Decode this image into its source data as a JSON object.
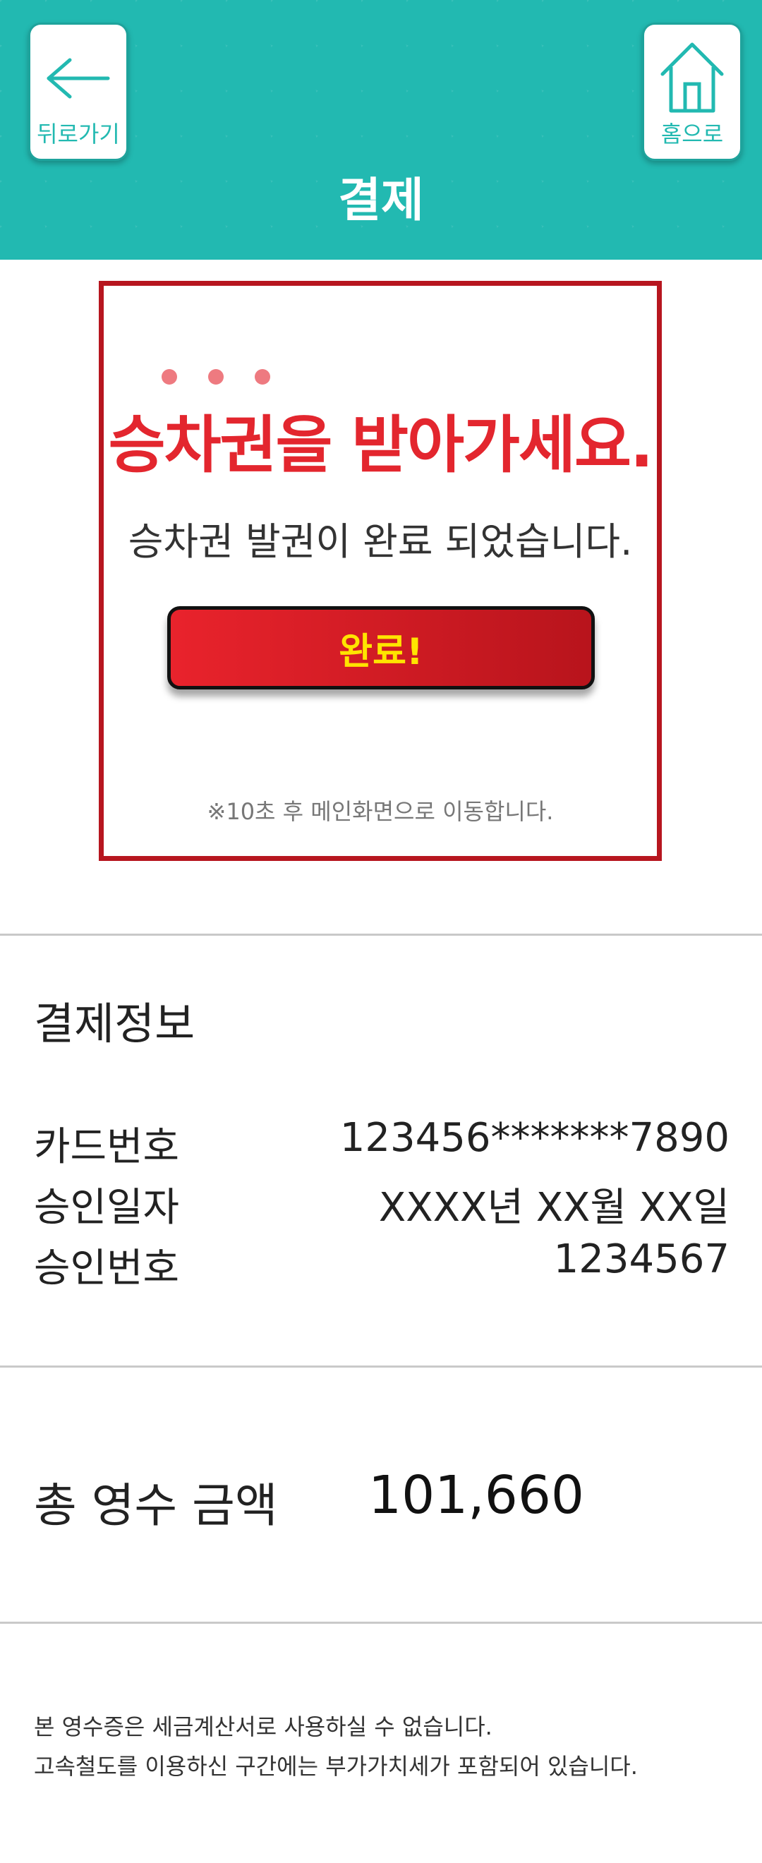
{
  "header": {
    "title": "결제",
    "back_label": "뒤로가기",
    "home_label": "홈으로",
    "back_icon": "arrow-left-icon",
    "home_icon": "house-icon",
    "color": "#22b9b1"
  },
  "notice": {
    "headline": "승차권을 받아가세요.",
    "message": "승차권 발권이 완료 되었습니다.",
    "button_label": "완료!",
    "auto_note": "※10초 후 메인화면으로 이동합니다.",
    "border_color": "#b7161f",
    "headline_color": "#e3262e",
    "button_text_color": "#ffe400"
  },
  "payment_info": {
    "title": "결제정보",
    "rows": [
      {
        "label": "카드번호",
        "value": "123456*******7890"
      },
      {
        "label": "승인일자",
        "value": "XXXX년 XX월 XX일"
      },
      {
        "label": "승인번호",
        "value": "1234567"
      }
    ]
  },
  "total": {
    "label": "총 영수 금액",
    "value": "101,660"
  },
  "footnotes": [
    "본 영수증은 세금계산서로 사용하실 수 없습니다.",
    "고속철도를 이용하신 구간에는 부가가치세가 포함되어 있습니다."
  ]
}
